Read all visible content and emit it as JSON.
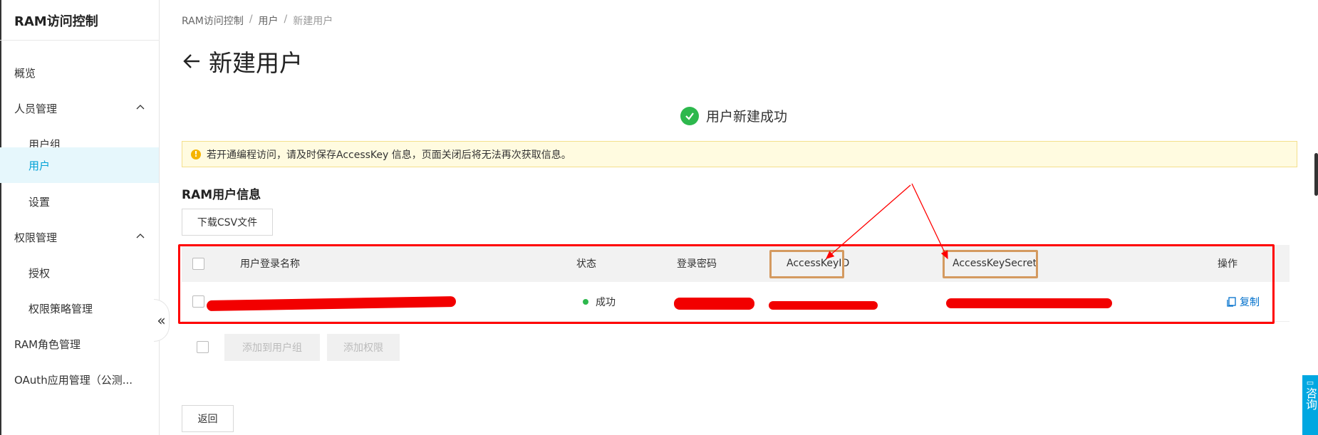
{
  "sidebar": {
    "title": "RAM访问控制",
    "items": [
      {
        "label": "概览"
      },
      {
        "label": "人员管理"
      },
      {
        "label": "用户组"
      },
      {
        "label": "用户"
      },
      {
        "label": "设置"
      },
      {
        "label": "权限管理"
      },
      {
        "label": "授权"
      },
      {
        "label": "权限策略管理"
      },
      {
        "label": "RAM角色管理"
      },
      {
        "label": "OAuth应用管理（公测..."
      }
    ],
    "collapse_glyph": "«"
  },
  "breadcrumb": [
    "RAM访问控制",
    "用户",
    "新建用户"
  ],
  "breadcrumb_sep": "/",
  "page": {
    "title": "新建用户"
  },
  "success": {
    "text": "用户新建成功"
  },
  "notice": {
    "text": "若开通编程访问，请及时保存AccessKey 信息，页面关闭后将无法再次获取信息。"
  },
  "section": {
    "title": "RAM用户信息",
    "download_button": "下载CSV文件"
  },
  "table": {
    "columns": [
      "用户登录名称",
      "状态",
      "登录密码",
      "AccessKeyID",
      "AccessKeySecret",
      "操作"
    ],
    "row": {
      "status": "成功",
      "action": "复制"
    }
  },
  "footer_buttons": {
    "add_to_group": "添加到用户组",
    "add_permission": "添加权限",
    "back": "返回"
  },
  "consult": {
    "label": "咨询"
  },
  "colors": {
    "accent": "#00a1d6",
    "success": "#2db84d",
    "annotation_red": "#f00000",
    "highlight_orange": "#d49a60"
  }
}
